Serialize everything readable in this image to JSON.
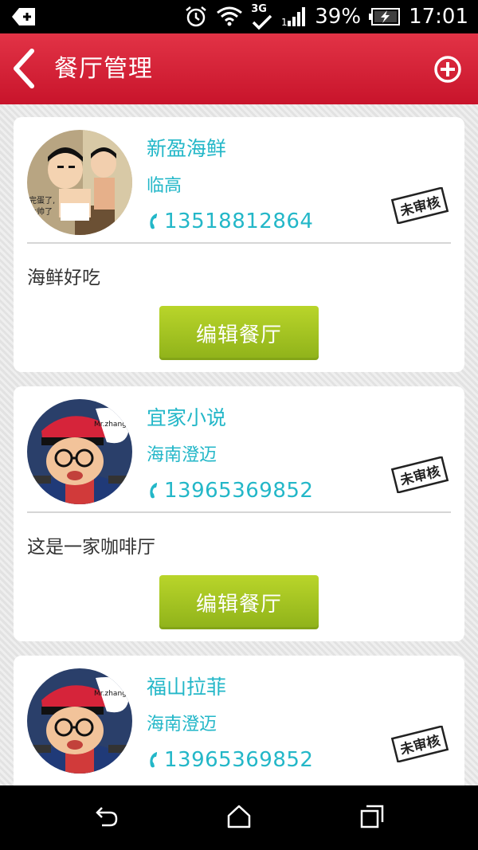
{
  "status_bar": {
    "battery": "39%",
    "time": "17:01",
    "network": "3G"
  },
  "app_bar": {
    "title": "餐厅管理"
  },
  "restaurants": [
    {
      "name": "新盈海鲜",
      "location": "临高",
      "phone": "13518812864",
      "description": "海鲜好吃",
      "status": "未审核",
      "edit_label": "编辑餐厅",
      "avatar": "cartoon-boy-avatar"
    },
    {
      "name": "宜家小说",
      "location": "海南澄迈",
      "phone": "13965369852",
      "description": "这是一家咖啡厅",
      "status": "未审核",
      "edit_label": "编辑餐厅",
      "avatar": "mr-zhang-avatar"
    },
    {
      "name": "福山拉菲",
      "location": "海南澄迈",
      "phone": "13965369852",
      "status": "未审核",
      "avatar": "mr-zhang-avatar"
    }
  ],
  "colors": {
    "accent": "#23b7c8",
    "app_bar": "#d41e34",
    "button": "#a3c421"
  }
}
